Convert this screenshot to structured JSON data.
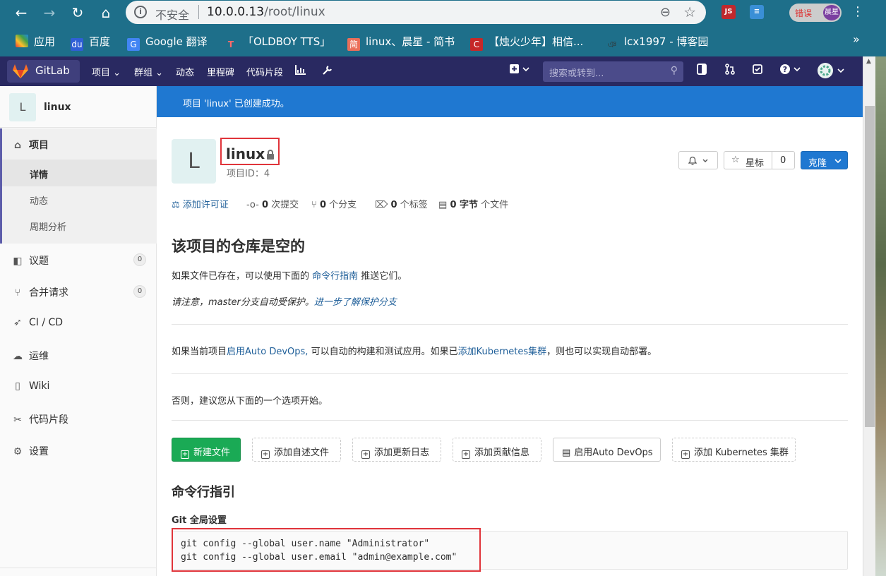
{
  "browser": {
    "url_insecure": "不安全",
    "url_host": "10.0.0.13",
    "url_path": "/root/linux",
    "profile_tag": "错误",
    "profile_name": "晨星",
    "ext_js": "JS",
    "bookmarks": [
      {
        "label": "应用"
      },
      {
        "label": "百度"
      },
      {
        "label": "Google 翻译"
      },
      {
        "label": "「OLDBOY TTS」"
      },
      {
        "label": "linux、晨星 - 简书"
      },
      {
        "label": "【烛火少年】相信..."
      },
      {
        "label": "lcx1997 - 博客园"
      }
    ],
    "bookmarks_more": "»"
  },
  "gitlab_nav": {
    "brand": "GitLab",
    "menu": [
      "项目 ⌄",
      "群组 ⌄",
      "动态",
      "里程碑",
      "代码片段"
    ],
    "search_placeholder": "搜索或转到..."
  },
  "sidebar": {
    "project_initial": "L",
    "project_name": "linux",
    "items": [
      {
        "label": "项目"
      },
      {
        "label": "详情"
      },
      {
        "label": "动态"
      },
      {
        "label": "周期分析"
      },
      {
        "label": "议题",
        "count": "0"
      },
      {
        "label": "合并请求",
        "count": "0"
      },
      {
        "label": "CI / CD"
      },
      {
        "label": "运维"
      },
      {
        "label": "Wiki"
      },
      {
        "label": "代码片段"
      },
      {
        "label": "设置"
      }
    ]
  },
  "alert": "项目 'linux' 已创建成功。",
  "project": {
    "initial": "L",
    "title": "linux",
    "id_label": "项目ID：4",
    "star_label": "星标",
    "star_count": "0",
    "clone_label": "克隆"
  },
  "stats": {
    "license": "添加许可证",
    "commits_count": "0",
    "commits_label": "次提交",
    "branches_count": "0",
    "branches_label": "个分支",
    "tags_count": "0",
    "tags_label": "个标签",
    "files_count": "0 字节",
    "files_label": "个文件"
  },
  "empty": {
    "heading": "该项目的仓库是空的",
    "p1_pre": "如果文件已存在，可以使用下面的 ",
    "p1_link": "命令行指南",
    "p1_post": " 推送它们。",
    "p2_pre": "请注意，master分支自动受保护。",
    "p2_link": "进一步了解保护分支",
    "p3_pre": "如果当前项目",
    "p3_link1": "启用Auto DevOps,",
    "p3_mid": " 可以自动的构建和测试应用。如果已",
    "p3_link2": "添加Kubernetes集群",
    "p3_post": "，则也可以实现自动部署。",
    "p4": "否则，建议您从下面的一个选项开始。"
  },
  "actions": [
    "新建文件",
    "添加自述文件",
    "添加更新日志",
    "添加贡献信息",
    "启用Auto DevOps",
    "添加 Kubernetes 集群"
  ],
  "cli": {
    "heading": "命令行指引",
    "git_global": "Git 全局设置",
    "code_line1": "git config --global user.name \"Administrator\"",
    "code_line2": "git config --global user.email \"admin@example.com\""
  }
}
